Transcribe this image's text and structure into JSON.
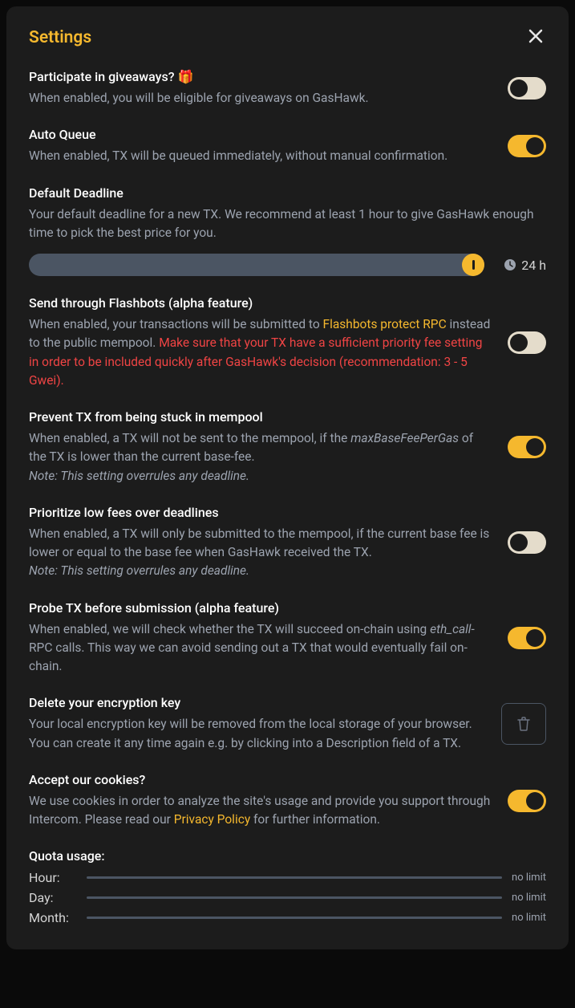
{
  "title": "Settings",
  "settings": {
    "giveaways": {
      "title": "Participate in giveaways? 🎁",
      "desc": "When enabled, you will be eligible for giveaways on GasHawk.",
      "on": false
    },
    "autoQueue": {
      "title": "Auto Queue",
      "desc": "When enabled, TX will be queued immediately, without manual confirmation.",
      "on": true
    },
    "deadline": {
      "title": "Default Deadline",
      "desc": "Your default deadline for a new TX. We recommend at least 1 hour to give GasHawk enough time to pick the best price for you.",
      "value": "24 h"
    },
    "flashbots": {
      "title": "Send through Flashbots (alpha feature)",
      "desc_pre": "When enabled, your transactions will be submitted to ",
      "link": "Flashbots protect RPC",
      "desc_mid": " instead to the public mempool. ",
      "warning": "Make sure that your TX have a sufficient priority fee setting in order to be included quickly after GasHawk's decision (recommendation: 3 - 5 Gwei).",
      "on": false
    },
    "preventStuck": {
      "title": "Prevent TX from being stuck in mempool",
      "desc_pre": "When enabled, a TX will not be sent to the mempool, if the ",
      "italic1": "maxBaseFeePerGas",
      "desc_post": " of the TX is lower than the current base-fee.",
      "note": "Note: This setting overrules any deadline.",
      "on": true
    },
    "prioritizeLow": {
      "title": "Prioritize low fees over deadlines",
      "desc": "When enabled, a TX will only be submitted to the mempool, if the current base fee is lower or equal to the base fee when GasHawk received the TX.",
      "note": "Note: This setting overrules any deadline.",
      "on": false
    },
    "probe": {
      "title": "Probe TX before submission (alpha feature)",
      "desc_pre": "When enabled, we will check whether the TX will succeed on-chain using ",
      "italic1": "eth_call",
      "desc_post": "-RPC calls. This way we can avoid sending out a TX that would eventually fail on-chain.",
      "on": true
    },
    "deleteKey": {
      "title": "Delete your encryption key",
      "desc": "Your local encryption key will be removed from the local storage of your browser. You can create it any time again e.g. by clicking into a Description field of a TX."
    },
    "cookies": {
      "title": "Accept our cookies?",
      "desc_pre": "We use cookies in order to analyze the site's usage and provide you support through Intercom. Please read our ",
      "link": "Privacy Policy",
      "desc_post": " for further information.",
      "on": true
    },
    "quota": {
      "title": "Quota usage:",
      "rows": [
        {
          "label": "Hour:",
          "limit": "no limit"
        },
        {
          "label": "Day:",
          "limit": "no limit"
        },
        {
          "label": "Month:",
          "limit": "no limit"
        }
      ]
    }
  }
}
